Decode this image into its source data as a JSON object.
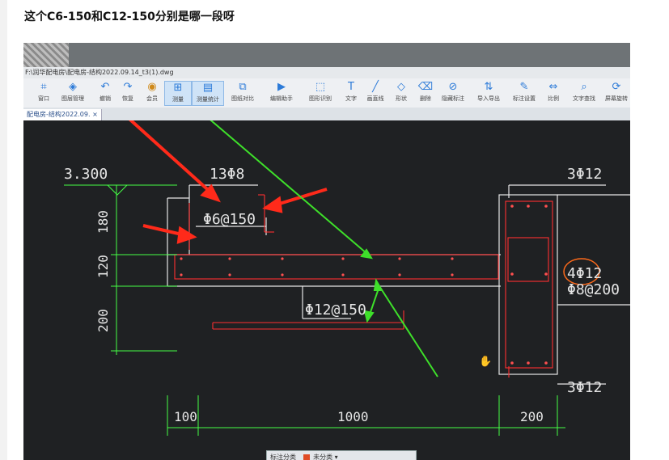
{
  "question": "这个C6-150和C12-150分别是哪一段呀",
  "window": {
    "path": "F:\\润华配电房\\配电房-结构2022.09.14_t3(1).dwg"
  },
  "toolbar": {
    "items": [
      {
        "label": "窗口",
        "icon": "window-icon"
      },
      {
        "label": "图层管理",
        "icon": "layers-icon"
      },
      {
        "label": "撤销",
        "icon": "undo-icon"
      },
      {
        "label": "恢复",
        "icon": "redo-icon"
      },
      {
        "label": "会员",
        "icon": "vip-icon"
      },
      {
        "label": "测量",
        "icon": "measure-icon"
      },
      {
        "label": "测量统计",
        "icon": "measure-stats-icon"
      },
      {
        "label": "图纸对比",
        "icon": "compare-icon"
      },
      {
        "label": "编辑助手",
        "icon": "edit-icon"
      },
      {
        "label": "图形识别",
        "icon": "recognize-icon"
      },
      {
        "label": "文字",
        "icon": "text-icon"
      },
      {
        "label": "画直线",
        "icon": "line-icon"
      },
      {
        "label": "形状",
        "icon": "shape-icon"
      },
      {
        "label": "删除",
        "icon": "eraser-icon"
      },
      {
        "label": "隐藏标注",
        "icon": "hide-icon"
      },
      {
        "label": "导入导出",
        "icon": "import-export-icon"
      },
      {
        "label": "标注设置",
        "icon": "annotation-settings-icon"
      },
      {
        "label": "比例",
        "icon": "scale-icon"
      },
      {
        "label": "文字查找",
        "icon": "text-search-icon"
      },
      {
        "label": "屏幕旋转",
        "icon": "rotate-icon"
      }
    ]
  },
  "tab": {
    "label": "配电房-结构2022.09.",
    "close": "×"
  },
  "drawing": {
    "elevation": "3.300",
    "dims_left": [
      "180",
      "120",
      "200"
    ],
    "dims_bottom": [
      "100",
      "1000",
      "200"
    ],
    "rebar_top": "13Φ8",
    "rebar_stirrup_slab": "Φ6@150",
    "rebar_bottom": "Φ12@150",
    "beam_top": "3Φ12",
    "beam_side": "4Φ12",
    "beam_stirrup": "Φ8@200",
    "beam_bottom": "3Φ12"
  },
  "statusbar": {
    "left": "标注分类",
    "middle": "未分类",
    "arrow": "▾"
  },
  "colors": {
    "annotation_red": "#ff2a1a",
    "annotation_green": "#3ee02a",
    "cad_white": "#e6e6e6",
    "cad_red": "#ff3030",
    "cad_green": "#44ff44"
  }
}
